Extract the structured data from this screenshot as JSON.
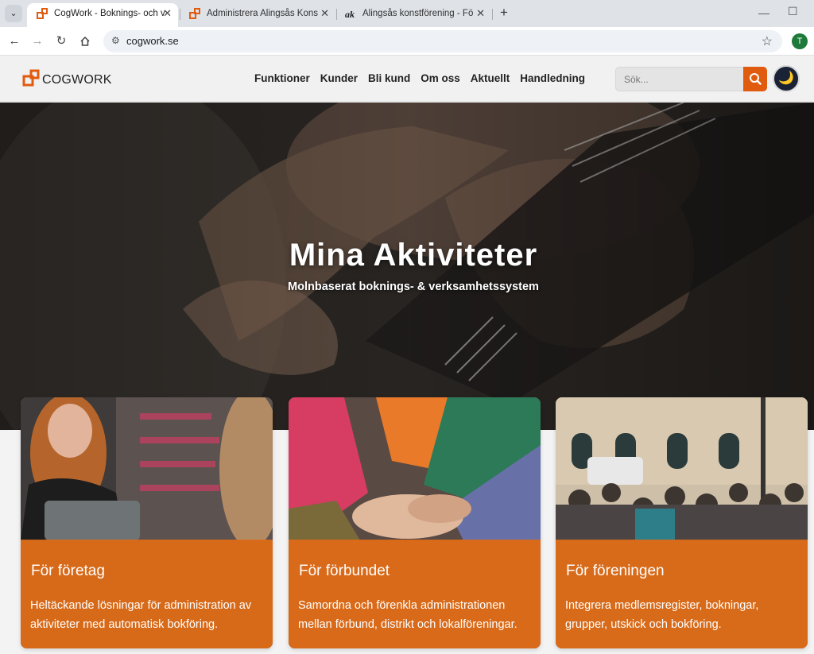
{
  "browser": {
    "tabs": [
      {
        "title": "CogWork - Boknings- och verks",
        "active": true,
        "icon": "cogwork-icon"
      },
      {
        "title": "Administrera Alingsås Konstföre",
        "active": false,
        "icon": "cogwork-icon"
      },
      {
        "title": "Alingsås konstförening - För kons",
        "active": false,
        "icon": "ak-icon"
      }
    ],
    "url": "cogwork.se",
    "profile_initial": "T"
  },
  "site": {
    "logo_text": "COGWORK",
    "nav": [
      "Funktioner",
      "Kunder",
      "Bli kund",
      "Om oss",
      "Aktuellt",
      "Handledning"
    ],
    "search_placeholder": "Sök...",
    "accent_color": "#e15b0f",
    "theme_icon": "moon-icon"
  },
  "hero": {
    "title": "Mina Aktiviteter",
    "subtitle": "Molnbaserat boknings- & verksamhetssystem"
  },
  "cards": [
    {
      "title": "För företag",
      "text": "Heltäckande lösningar för administration av aktiviteter med automatisk bokföring."
    },
    {
      "title": "För förbundet",
      "text": "Samordna och förenkla administrationen mellan förbund, distrikt och lokalföreningar."
    },
    {
      "title": "För föreningen",
      "text": "Integrera medlemsregister, bokningar, grupper, utskick och bokföring."
    }
  ]
}
